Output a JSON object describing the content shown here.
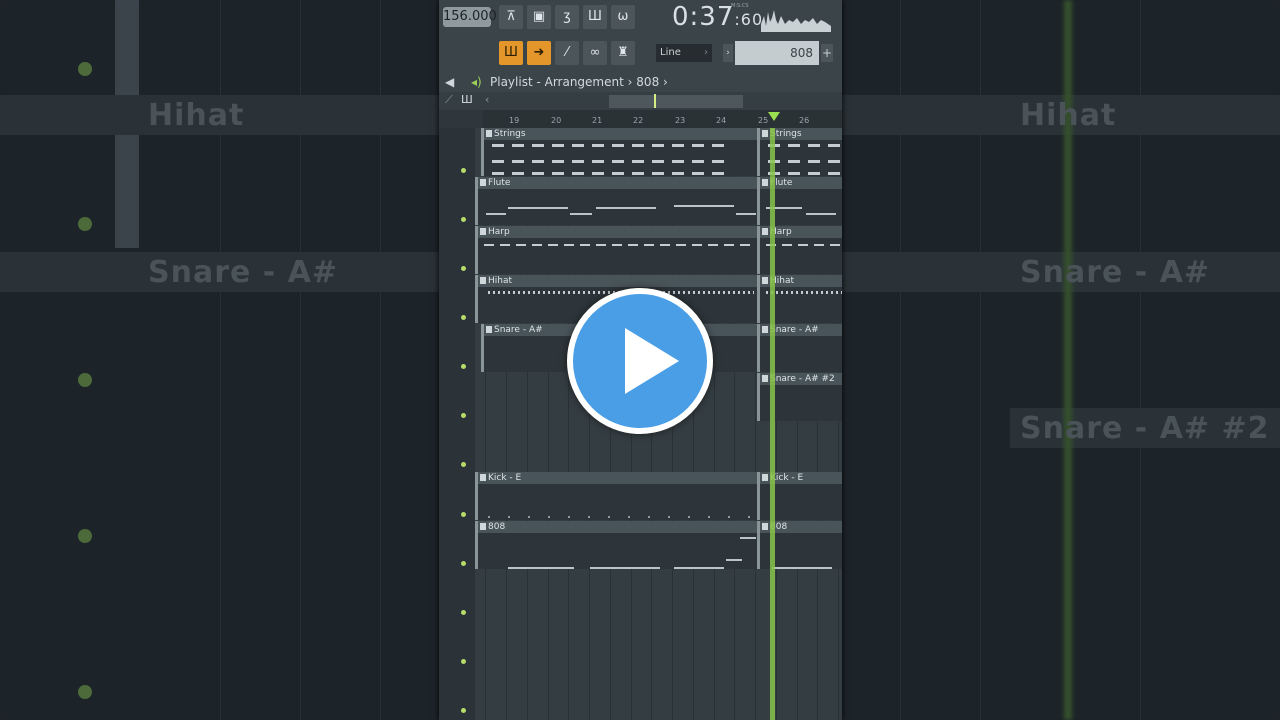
{
  "toolbar": {
    "tempo": "156.000",
    "time_main": "0:37",
    "time_sub": "60",
    "time_label": "M:S:CS",
    "snap_mode": "Line",
    "pattern": "808",
    "buttons": [
      "metronome-icon",
      "step-record-icon",
      "count-in-icon",
      "blend-notes-icon",
      "loop-record-icon",
      "typing-keyboard-icon",
      "arrow-icon",
      "brush-icon",
      "link-icon",
      "stamp-icon"
    ]
  },
  "titlebar": {
    "playlist": "Playlist - Arrangement",
    "separator": "›",
    "pattern": "808",
    "end": "›"
  },
  "ruler": {
    "ticks": [
      "19",
      "20",
      "21",
      "22",
      "23",
      "24",
      "25",
      "26"
    ]
  },
  "tracks": [
    {
      "name": "Strings",
      "name2": "Strings"
    },
    {
      "name": "Flute",
      "name2": "Flute"
    },
    {
      "name": "Harp",
      "name2": "Harp"
    },
    {
      "name": "Hihat",
      "name2": "Hihat"
    },
    {
      "name": "Snare - A#",
      "name2": "Snare - A#"
    },
    {
      "name": "",
      "name2": "Snare - A# #2"
    },
    {
      "name": "",
      "name2": ""
    },
    {
      "name": "Kick - E",
      "name2": "Kick - E"
    },
    {
      "name": "808",
      "name2": "808"
    }
  ],
  "background": {
    "label1": "Hihat",
    "label2": "Snare - A#",
    "label3": "Snare - A#",
    "label4": "Hihat",
    "label5": "Snare - A# #2"
  },
  "colors": {
    "accent": "#e4962b",
    "playhead": "#88c44a",
    "play_button": "#4a9ee6"
  }
}
